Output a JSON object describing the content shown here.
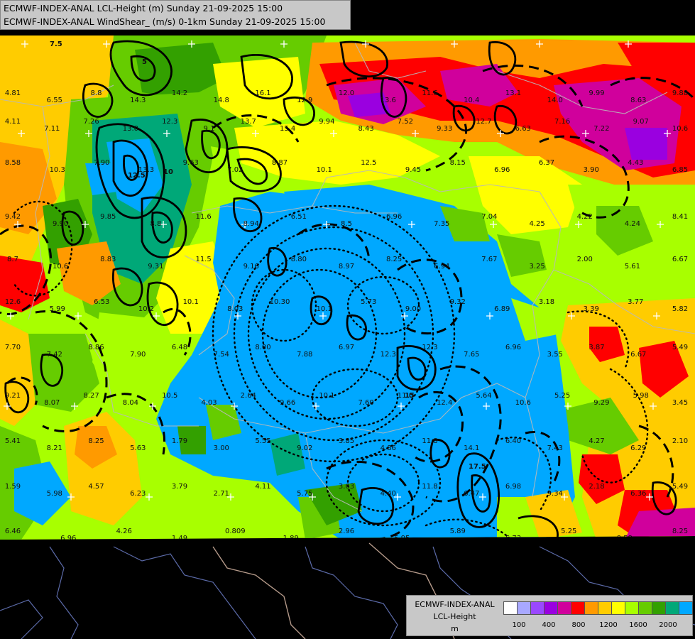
{
  "header": {
    "line1": "ECMWF-INDEX-ANAL LCL-Height (m) Sunday 21-09-2025 15:00",
    "line2": "ECMWF-INDEX-ANAL WindShear_ (m/s) 0-1km Sunday 21-09-2025 15:00"
  },
  "legend": {
    "line1": "ECMWF-INDEX-ANAL",
    "line2": "LCL-Height",
    "line3": "m",
    "colors": [
      "#ffffff",
      "#a8a8ff",
      "#9a48ff",
      "#9a00e0",
      "#d0009c",
      "#ff0000",
      "#ff9a00",
      "#ffcc00",
      "#ffff00",
      "#a8ff00",
      "#66cc00",
      "#33a000",
      "#00a878",
      "#00a8ff"
    ],
    "ticks": [
      "100",
      "400",
      "800",
      "1200",
      "1600",
      "2000"
    ]
  },
  "map_labels": [
    "4.81",
    "6.55",
    "8.8",
    "14.3",
    "14.2",
    "14.8",
    "16.1",
    "12.9",
    "12.0",
    "13.6",
    "11.6",
    "10.4",
    "13.1",
    "14.0",
    "9.99",
    "8.63",
    "9.88",
    "4.11",
    "7.11",
    "7.26",
    "13.0",
    "12.3",
    "9.1",
    "13.7",
    "15.4",
    "9.94",
    "8.43",
    "7.52",
    "9.33",
    "12.7",
    "6.63",
    "7.16",
    "7.22",
    "9.07",
    "10.6",
    "8.58",
    "10.3",
    "7.90",
    "13.3",
    "9.63",
    "7.02",
    "8.87",
    "10.1",
    "12.5",
    "9.45",
    "8.15",
    "6.96",
    "6.37",
    "3.90",
    "4.43",
    "6.85",
    "9.42",
    "9.90",
    "9.85",
    "8.8",
    "11.6",
    "8.94",
    "6.51",
    "8.5",
    "6.96",
    "7.35",
    "7.04",
    "4.25",
    "4.22",
    "4.24",
    "8.41",
    "8.7",
    "10.6",
    "8.83",
    "9.31",
    "11.5",
    "9.16",
    "8.80",
    "8.97",
    "8.25",
    "6.94",
    "7.67",
    "3.25",
    "2.00",
    "5.61",
    "6.67",
    "12.6",
    "5.99",
    "6.53",
    "10.2",
    "10.1",
    "8.03",
    "10.30",
    "10.1",
    "5.73",
    "9.00",
    "9.32",
    "6.89",
    "3.18",
    "3.39",
    "3.77",
    "5.82",
    "7.70",
    "7.42",
    "8.86",
    "7.90",
    "6.48",
    "7.54",
    "8.00",
    "7.88",
    "6.97",
    "12.3",
    "12.3",
    "7.65",
    "6.96",
    "3.55",
    "3.87",
    "6.67",
    "5.49",
    "9.21",
    "8.07",
    "8.27",
    "8.04",
    "10.5",
    "4.03",
    "2.64",
    "9.66",
    "10.1",
    "7.60",
    "11.0",
    "12.4",
    "5.64",
    "10.6",
    "5.25",
    "9.29",
    "5.98",
    "3.45",
    "5.41",
    "8.21",
    "8.25",
    "5.63",
    "1.79",
    "3.00",
    "5.55",
    "9.02",
    "3.85",
    "4.86",
    "11.8",
    "14.1",
    "6.40",
    "7.43",
    "4.27",
    "6.29",
    "2.10",
    "1.59",
    "5.98",
    "4.57",
    "6.23",
    "3.79",
    "2.71",
    "4.11",
    "5.75",
    "3.63",
    "4.40",
    "11.8",
    "6.47",
    "6.98",
    "9.34",
    "2.18",
    "6.36",
    "5.49",
    "6.46",
    "6.96",
    "4.26",
    "1.49",
    "0.809",
    "1.89",
    "2.96",
    "5.95",
    "5.89",
    "5.73",
    "5.25",
    "8.58",
    "8.25",
    "5",
    "7.5",
    "10",
    "12.5",
    "15",
    "17.5"
  ]
}
